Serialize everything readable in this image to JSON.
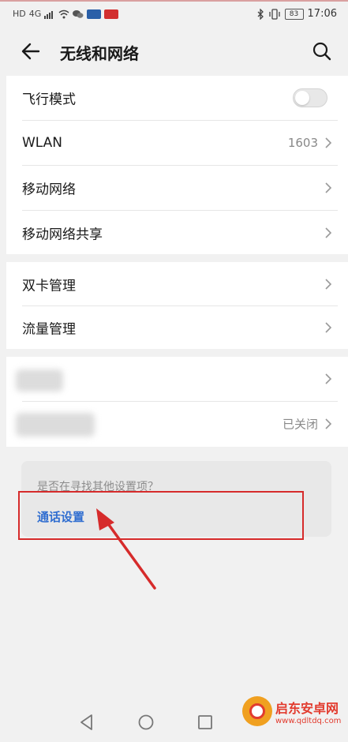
{
  "status_bar": {
    "left_icons": [
      "HD",
      "4G",
      "signal-icon",
      "wifi-icon",
      "wechat-icon",
      "app-icon-1",
      "app-icon-2"
    ],
    "right_icons": [
      "bluetooth-icon",
      "vibrate-icon"
    ],
    "battery": "83",
    "time": "17:06"
  },
  "header": {
    "title": "无线和网络"
  },
  "section1": {
    "airplane_mode": "飞行模式",
    "wlan": "WLAN",
    "wlan_value": "1603",
    "mobile_network": "移动网络",
    "tethering": "移动网络共享"
  },
  "section2": {
    "dual_sim": "双卡管理",
    "data_usage": "流量管理"
  },
  "section3": {
    "row2_value": "已关闭"
  },
  "suggestion": {
    "prompt": "是否在寻找其他设置项？",
    "link": "通话设置"
  },
  "watermark": {
    "name": "启东安卓网",
    "url": "www.qdltdq.com"
  },
  "colors": {
    "accent_link": "#2f6dd0",
    "highlight": "#d62b2b",
    "background": "#f1f1f1"
  }
}
